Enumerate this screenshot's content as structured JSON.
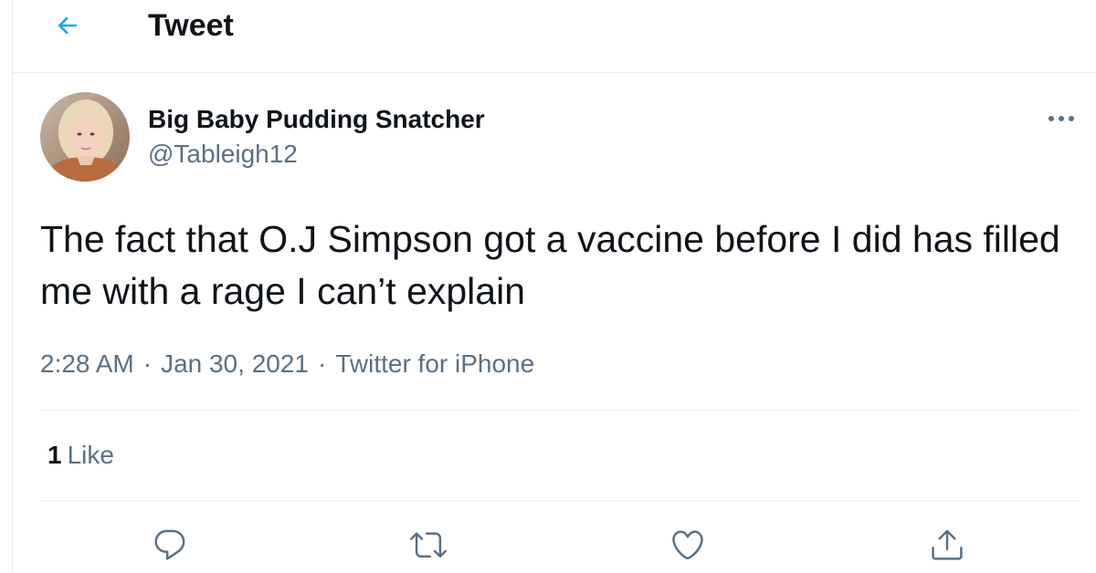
{
  "header": {
    "back_icon": "arrow-left-icon",
    "title": "Tweet"
  },
  "tweet": {
    "author": {
      "display_name": "Big Baby Pudding Snatcher",
      "handle": "@Tableigh12",
      "avatar": "profile-photo"
    },
    "more_icon": "more-horizontal-icon",
    "text": "The fact that O.J Simpson got a vaccine before I did has filled me with a rage I can’t explain",
    "time": "2:28 AM",
    "separator": "·",
    "date": "Jan 30, 2021",
    "source": "Twitter for iPhone",
    "likes": {
      "count": "1",
      "label": "Like"
    },
    "actions": [
      {
        "icon": "reply-icon"
      },
      {
        "icon": "retweet-icon"
      },
      {
        "icon": "like-heart-icon"
      },
      {
        "icon": "share-icon"
      }
    ]
  },
  "colors": {
    "accent": "#1da1f2",
    "text_primary": "#0f1419",
    "text_secondary": "#5b7083",
    "divider": "#e6ecf0"
  }
}
